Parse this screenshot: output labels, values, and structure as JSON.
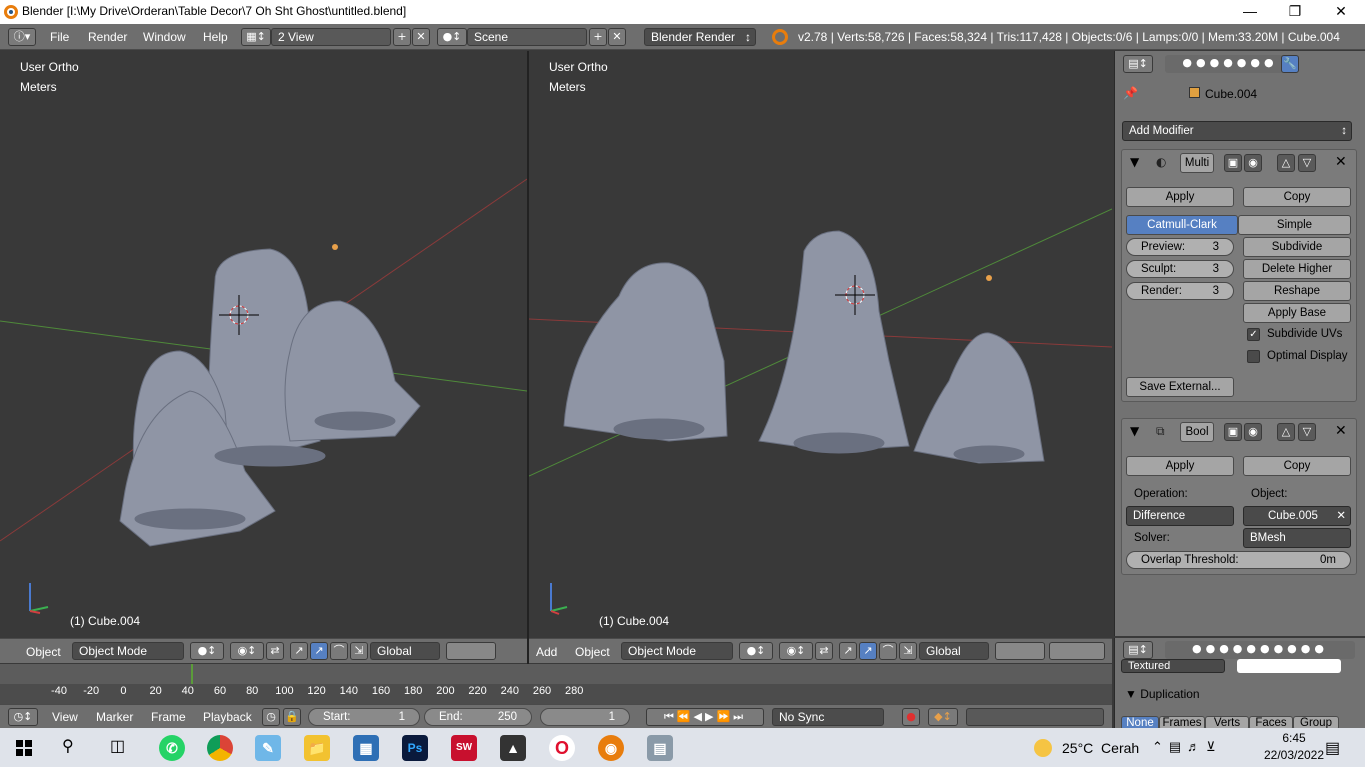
{
  "window": {
    "title": "Blender [I:\\My Drive\\Orderan\\Table Decor\\7 Oh Sht Ghost\\untitled.blend]"
  },
  "menubar": {
    "items": [
      "File",
      "Render",
      "Window",
      "Help"
    ],
    "layout": "2 View",
    "scene": "Scene",
    "engine": "Blender Render",
    "stats": "v2.78 | Verts:58,726 | Faces:58,324 | Tris:117,428 | Objects:0/6 | Lamps:0/0 | Mem:33.20M | Cube.004"
  },
  "viewport_left": {
    "view": "User Ortho",
    "units": "Meters",
    "object": "(1) Cube.004"
  },
  "viewport_right": {
    "view": "User Ortho",
    "units": "Meters",
    "object": "(1) Cube.004"
  },
  "footer_left": {
    "object_menu": "Object",
    "mode": "Object Mode",
    "orientation": "Global"
  },
  "footer_right": {
    "add_menu": "Add",
    "object_menu": "Object",
    "mode": "Object Mode",
    "orientation": "Global"
  },
  "properties": {
    "object_name": "Cube.004",
    "add_modifier": "Add Modifier",
    "multires": {
      "name": "Multi",
      "apply": "Apply",
      "copy": "Copy",
      "catmull": "Catmull-Clark",
      "simple": "Simple",
      "preview_label": "Preview:",
      "preview_value": "3",
      "sculpt_label": "Sculpt:",
      "sculpt_value": "3",
      "render_label": "Render:",
      "render_value": "3",
      "subdivide": "Subdivide",
      "delete_higher": "Delete Higher",
      "reshape": "Reshape",
      "apply_base": "Apply Base",
      "subdivide_uvs": "Subdivide UVs",
      "optimal_display": "Optimal Display",
      "save_external": "Save External..."
    },
    "boolean": {
      "name": "Bool",
      "apply": "Apply",
      "copy": "Copy",
      "operation_label": "Operation:",
      "operation": "Difference",
      "object_label": "Object:",
      "object": "Cube.005",
      "solver_label": "Solver:",
      "solver": "BMesh",
      "overlap_label": "Overlap Threshold:",
      "overlap_value": "0m"
    },
    "lower": {
      "textured": "Textured",
      "duplication": "Duplication",
      "dup_tabs": [
        "None",
        "Frames",
        "Verts",
        "Faces",
        "Group"
      ]
    }
  },
  "timeline": {
    "ticks": [
      "-40",
      "-20",
      "0",
      "20",
      "40",
      "60",
      "80",
      "100",
      "120",
      "140",
      "160",
      "180",
      "200",
      "220",
      "240",
      "260",
      "280"
    ],
    "current_frame": 1,
    "menus": [
      "View",
      "Marker",
      "Frame",
      "Playback"
    ],
    "start_label": "Start:",
    "start": "1",
    "end_label": "End:",
    "end": "250",
    "frame": "1",
    "sync": "No Sync"
  },
  "taskbar": {
    "weather": "25°C  Cerah",
    "time": "6:45",
    "date": "22/03/2022"
  }
}
